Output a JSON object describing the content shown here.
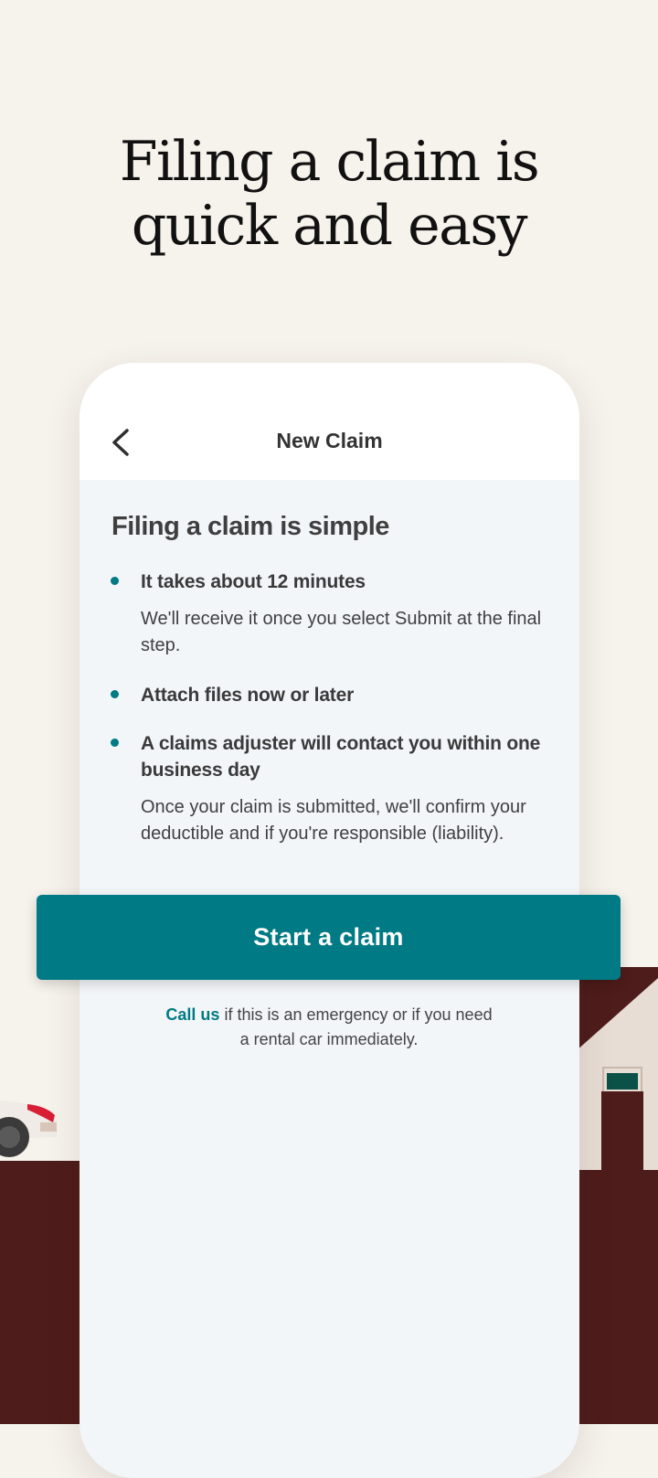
{
  "hero": {
    "title_line1": "Filing a claim is",
    "title_line2": "quick and easy"
  },
  "phone": {
    "header_title": "New Claim",
    "back_icon": "chevron-left-icon",
    "section_title": "Filing a claim is simple",
    "items": [
      {
        "title": "It takes about 12 minutes",
        "body": "We'll receive it once you select Submit at the final step."
      },
      {
        "title": "Attach files now or later",
        "body": ""
      },
      {
        "title": "A claims adjuster will contact you within one business day",
        "body": "Once your claim is submitted, we'll confirm your deductible and if you're responsible (liability)."
      }
    ]
  },
  "cta": {
    "start_label": "Start a claim"
  },
  "callout": {
    "link_label": "Call us",
    "text": " if this is an emergency or if you need a rental car immediately."
  },
  "colors": {
    "background": "#f6f2ec",
    "accent": "#007a85",
    "ground": "#4e1c1a",
    "card": "#f3f6f9"
  }
}
